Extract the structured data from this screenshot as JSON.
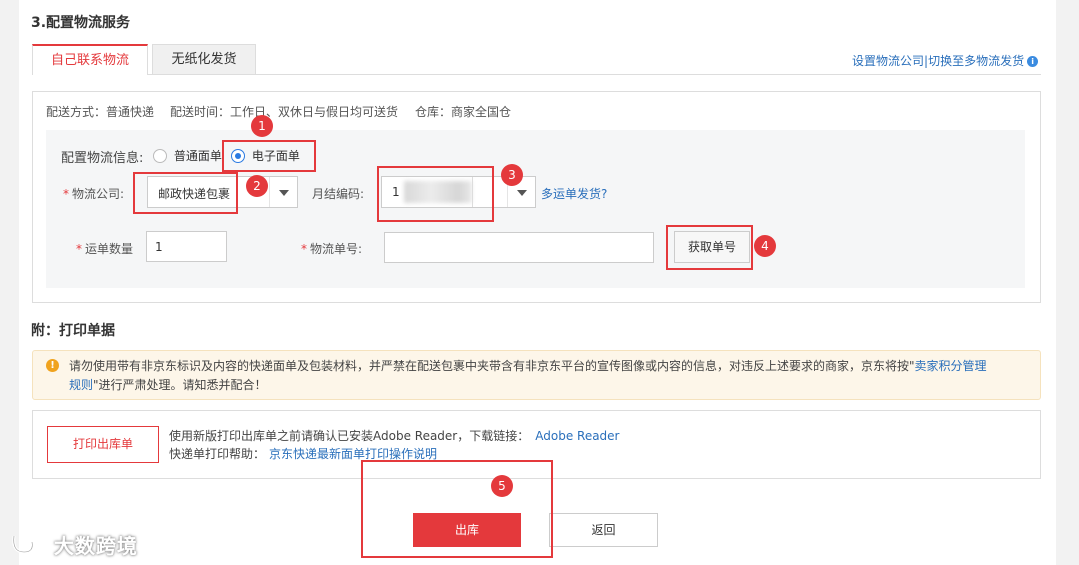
{
  "section_title": "3.配置物流服务",
  "tabs": [
    {
      "label": "自己联系物流",
      "active": true
    },
    {
      "label": "无纸化发货",
      "active": false
    }
  ],
  "top_links": {
    "set_company": "设置物流公司",
    "separator": "|",
    "switch_multi": "切换至多物流发货",
    "info_icon": "info-icon"
  },
  "meta": {
    "delivery_method": "配送方式：普通快递",
    "delivery_time": "配送时间：工作日、双休日与假日均可送货",
    "warehouse": "仓库：商家全国仓"
  },
  "logistics_info": {
    "label": "配置物流信息:",
    "options": [
      {
        "label": "普通面单",
        "checked": false
      },
      {
        "label": "电子面单",
        "checked": true
      }
    ]
  },
  "form": {
    "company_label": "物流公司:",
    "company_value": "邮政快递包裹",
    "account_label": "月结编码:",
    "account_value_prefix": "1",
    "multi_link": "多运单发货?",
    "count_label": "运单数量",
    "count_value": "1",
    "tracking_label": "物流单号:",
    "tracking_value": "",
    "get_number_button": "获取单号",
    "required_mark": "*"
  },
  "annotations": [
    "1",
    "2",
    "3",
    "4",
    "5"
  ],
  "attachment_title": "附：打印单据",
  "notice": {
    "icon": "warning-icon",
    "text_part1": "请勿使用带有非京东标识及内容的快递面单及包装材料，并严禁在配送包裹中夹带含有非京东平台的宣传图像或内容的信息，对违反上述要求的商家，京东将按\"",
    "link1": "卖家积分管理",
    "link2": "规则",
    "text_part2": "\"进行严肃处理。请知悉并配合！"
  },
  "print": {
    "button": "打印出库单",
    "line1_text": "使用新版打印出库单之前请确认已安装Adobe Reader，下载链接：",
    "line1_link": "Adobe Reader",
    "line2_text": "快递单打印帮助：",
    "line2_link": "京东快递最新面单打印操作说明"
  },
  "actions": {
    "ship": "出库",
    "back": "返回"
  },
  "watermark": "大数跨境",
  "colors": {
    "accent": "#e4393c",
    "link": "#2a6fbb",
    "radio": "#2a7ae2",
    "warning": "#f0a31e"
  }
}
